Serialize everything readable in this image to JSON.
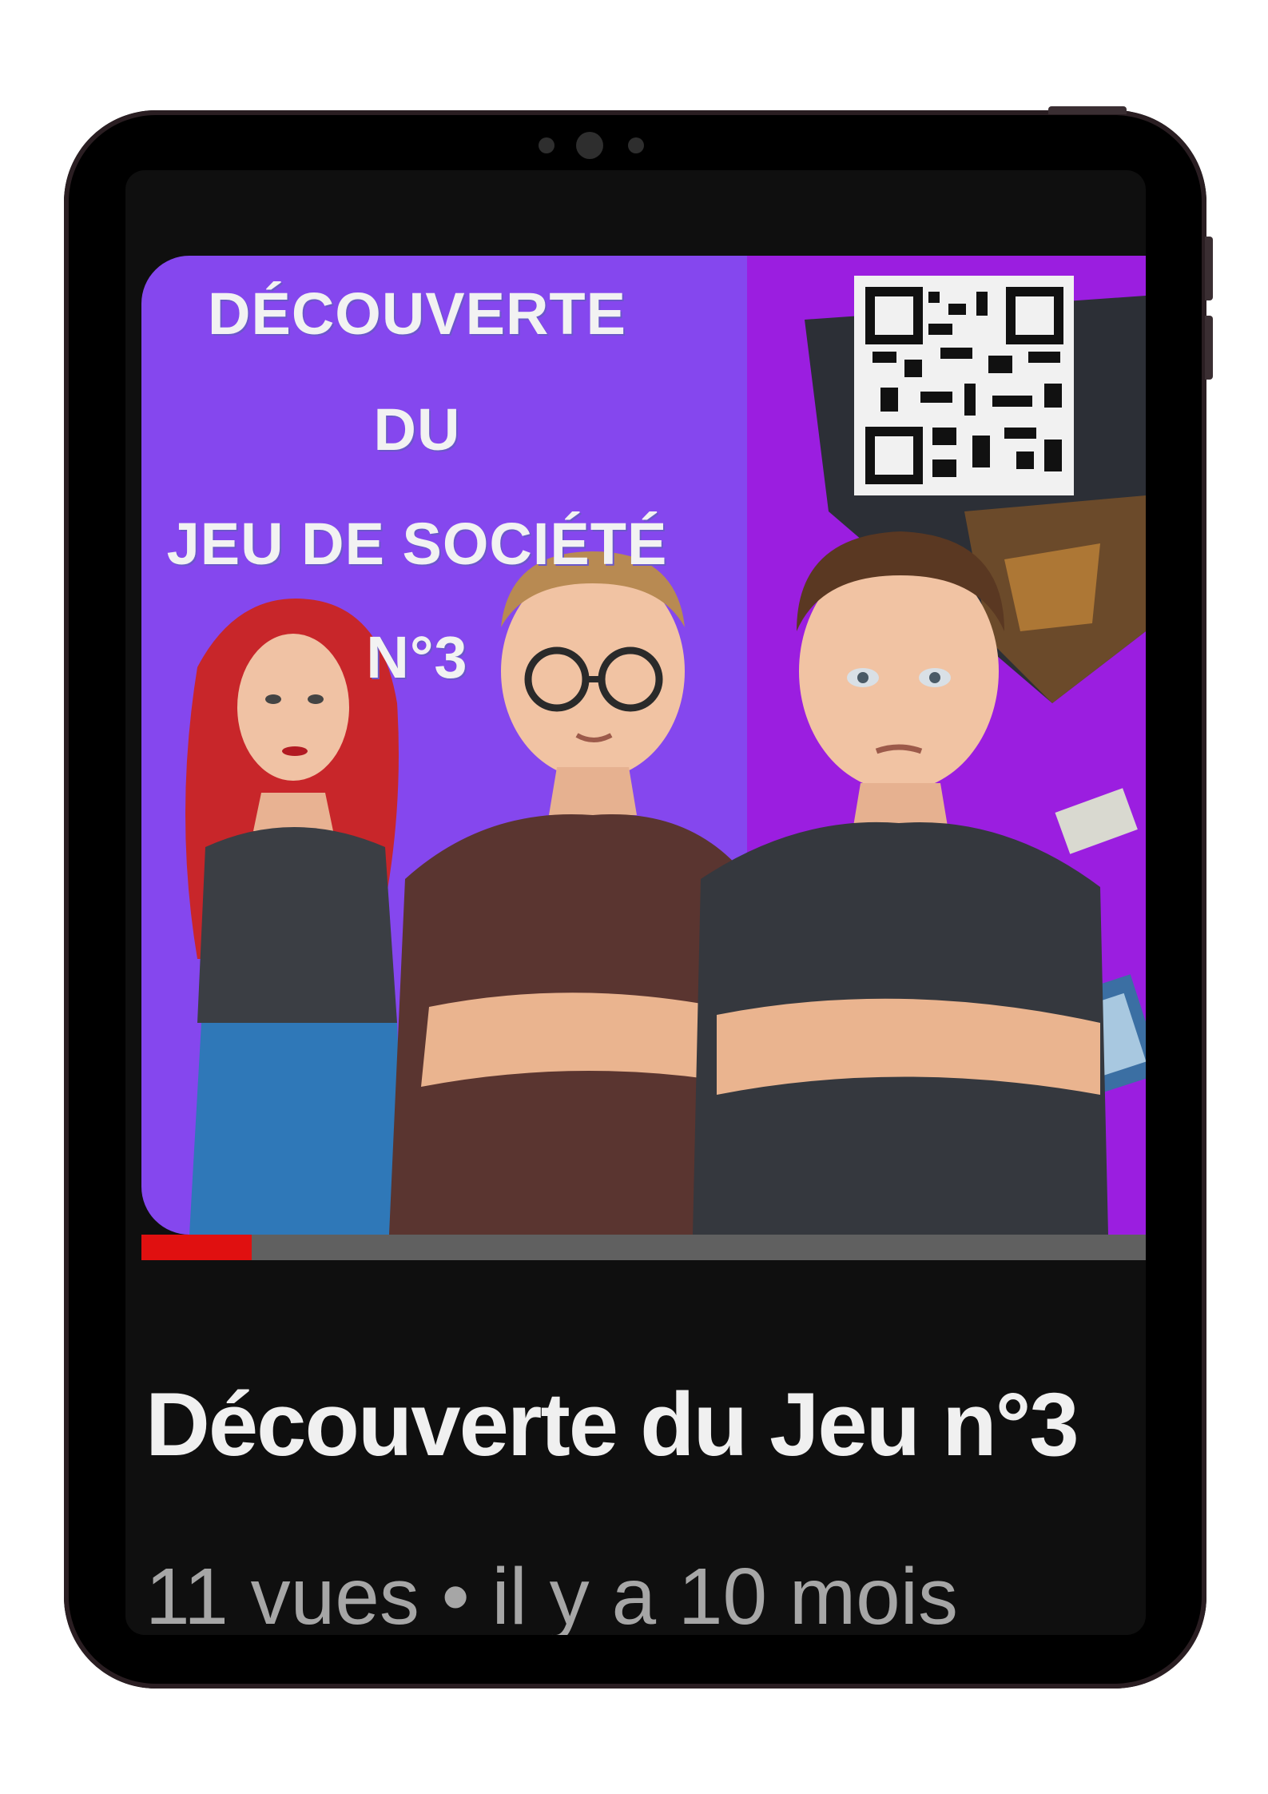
{
  "thumbnail": {
    "title_lines": [
      "DÉCOUVERTE",
      "DU",
      "JEU DE SOCIÉTÉ",
      "N°3"
    ],
    "colors": {
      "left_panel": "#8547ee",
      "right_panel": "#9b1ee0"
    }
  },
  "progress": {
    "watched_fraction": 0.11,
    "fill_color": "#e01010"
  },
  "video": {
    "title": "Découverte du Jeu n°3",
    "views": "11 vues",
    "separator": "•",
    "age": "il y a 10 mois"
  }
}
